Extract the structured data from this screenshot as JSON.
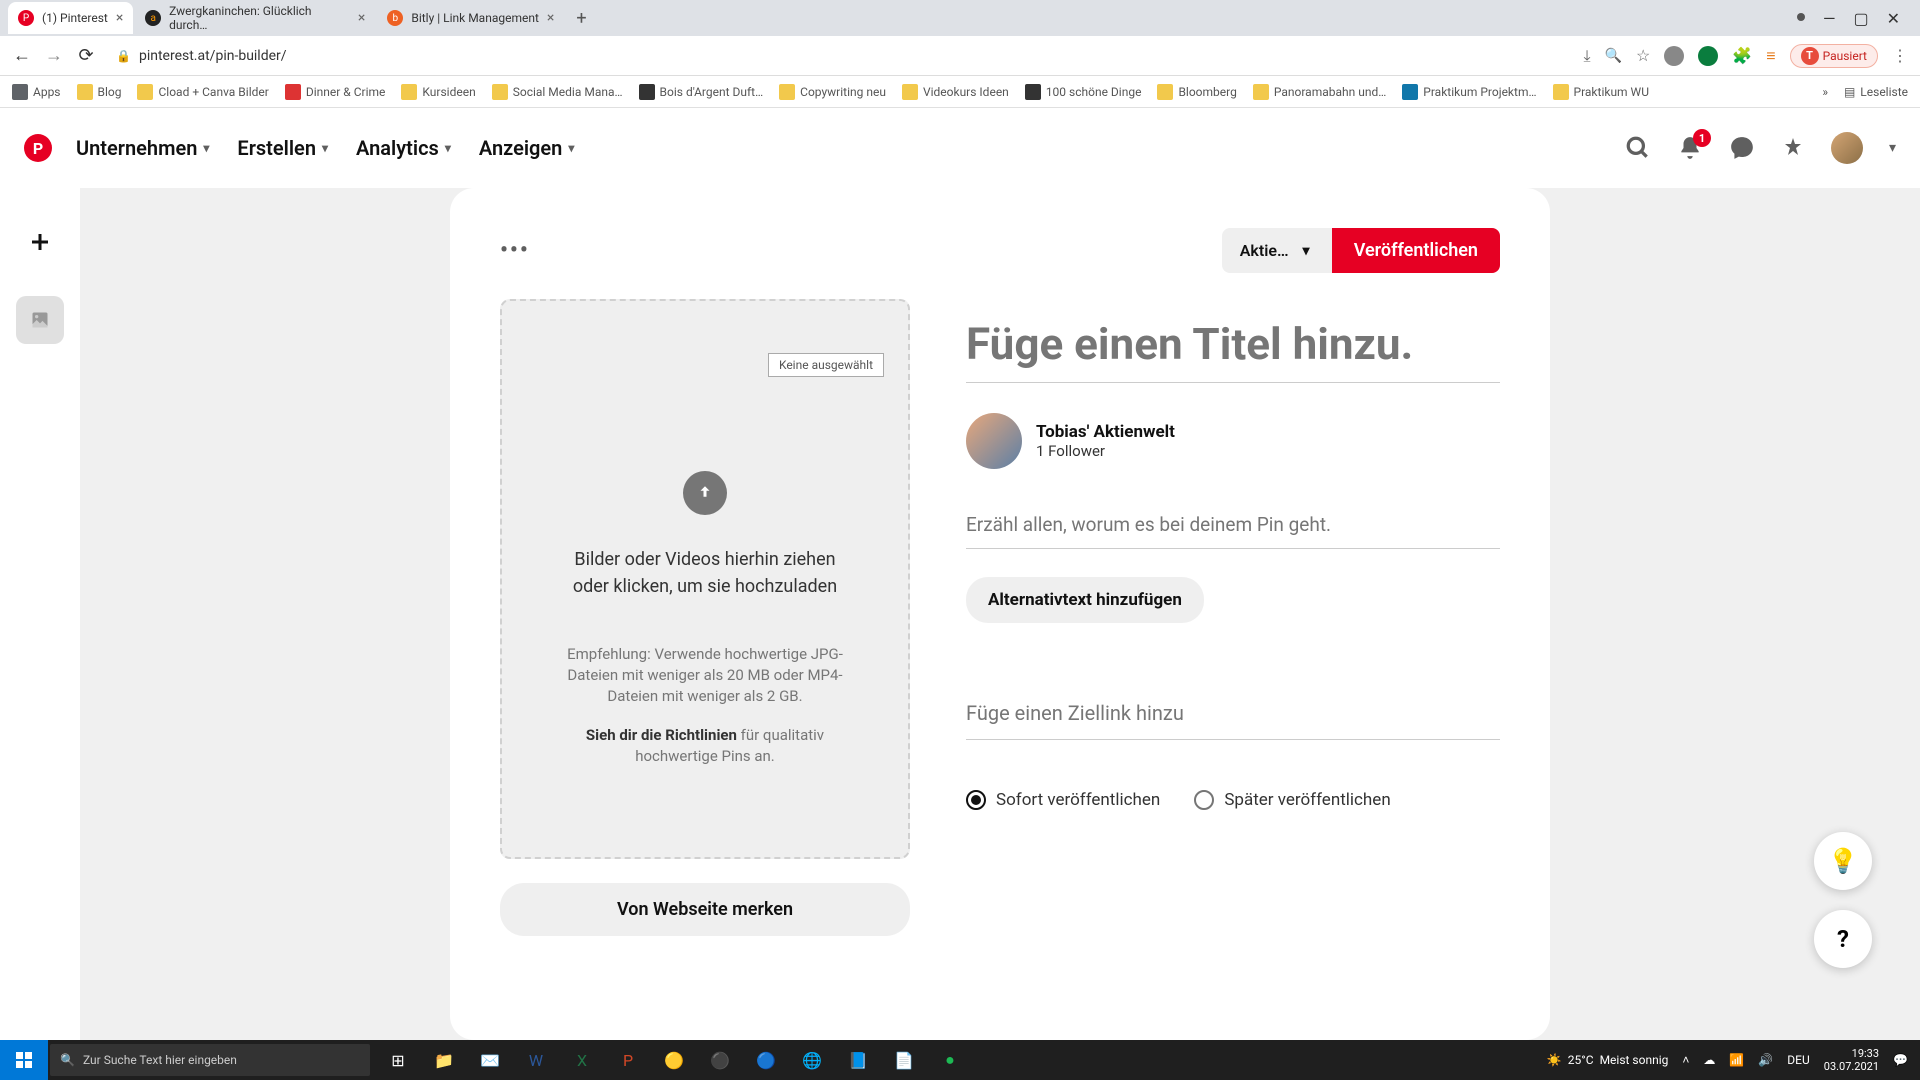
{
  "browser": {
    "tabs": [
      {
        "title": "(1) Pinterest",
        "favicon_bg": "#e60023",
        "favicon_text": "P"
      },
      {
        "title": "Zwergkaninchen: Glücklich durch…",
        "favicon_bg": "#222",
        "favicon_text": "a"
      },
      {
        "title": "Bitly | Link Management",
        "favicon_bg": "#ee6123",
        "favicon_text": "b"
      }
    ],
    "url": "pinterest.at/pin-builder/",
    "paused_label": "Pausiert",
    "bookmarks": [
      "Apps",
      "Blog",
      "Cload + Canva Bilder",
      "Dinner & Crime",
      "Kursideen",
      "Social Media Mana…",
      "Bois d'Argent Duft…",
      "Copywriting neu",
      "Videokurs Ideen",
      "100 schöne Dinge",
      "Bloomberg",
      "Panoramabahn und…",
      "Praktikum Projektm…",
      "Praktikum WU"
    ],
    "reading_list": "Leseliste"
  },
  "pinterest_nav": {
    "items": [
      "Unternehmen",
      "Erstellen",
      "Analytics",
      "Anzeigen"
    ],
    "notification_count": "1"
  },
  "builder": {
    "board_selected": "Aktie…",
    "publish_label": "Veröffentlichen",
    "file_badge": "Keine ausgewählt",
    "upload_text": "Bilder oder Videos hierhin ziehen oder klicken, um sie hochzuladen",
    "upload_hint": "Empfehlung: Verwende hochwertige JPG-Dateien mit weniger als 20 MB oder MP4-Dateien mit weniger als 2 GB.",
    "guidelines_bold": "Sieh dir die Richtlinien",
    "guidelines_rest": " für qualitativ hochwertige Pins an.",
    "from_web": "Von Webseite merken",
    "title_placeholder": "Füge einen Titel hinzu.",
    "profile_name": "Tobias' Aktienwelt",
    "profile_followers": "1 Follower",
    "desc_placeholder": "Erzähl allen, worum es bei deinem Pin geht.",
    "alt_text_label": "Alternativtext hinzufügen",
    "link_placeholder": "Füge einen Ziellink hinzu",
    "publish_now": "Sofort veröffentlichen",
    "publish_later": "Später veröffentlichen"
  },
  "taskbar": {
    "search_placeholder": "Zur Suche Text hier eingeben",
    "weather_temp": "25°C",
    "weather_desc": "Meist sonnig",
    "time": "19:33",
    "date": "03.07.2021",
    "lang": "DEU"
  }
}
